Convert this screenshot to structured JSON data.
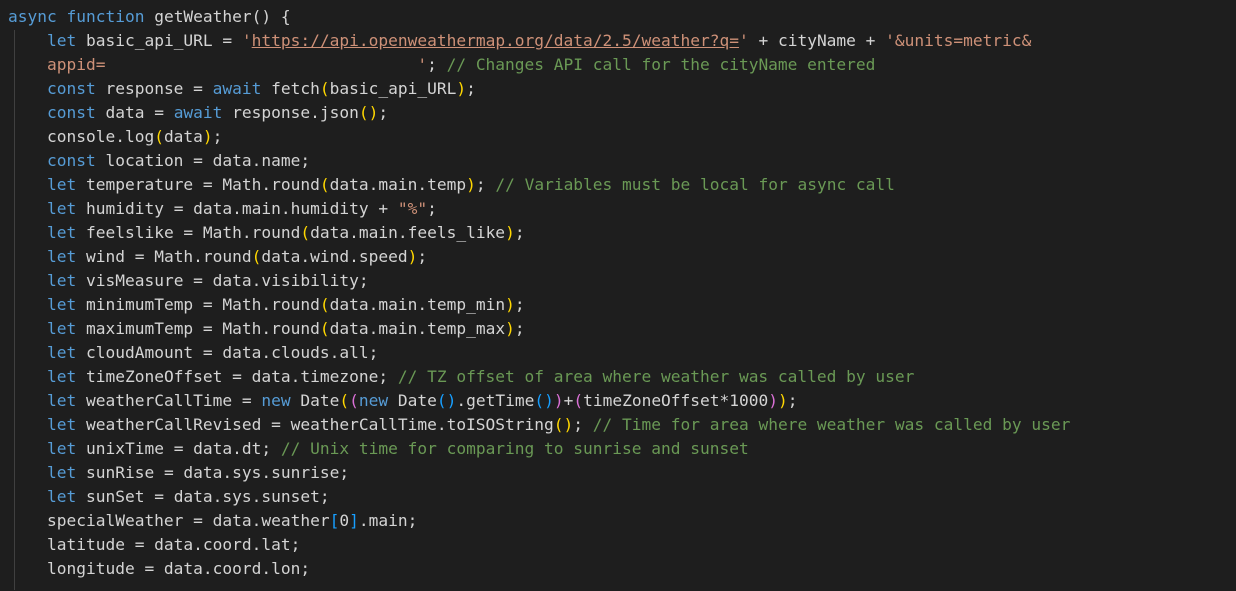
{
  "code_lines": [
    {
      "indent": "",
      "tokens": [
        {
          "t": "async",
          "c": "kw"
        },
        {
          "t": " ",
          "c": "plain"
        },
        {
          "t": "function",
          "c": "kw"
        },
        {
          "t": " getWeather() {",
          "c": "plain"
        }
      ]
    },
    {
      "indent": "    ",
      "tokens": [
        {
          "t": "let",
          "c": "kw"
        },
        {
          "t": " basic_api_URL = ",
          "c": "plain"
        },
        {
          "t": "'",
          "c": "str"
        },
        {
          "t": "https://api.openweathermap.org/data/2.5/weather?q=",
          "c": "link"
        },
        {
          "t": "'",
          "c": "str"
        },
        {
          "t": " + cityName + ",
          "c": "plain"
        },
        {
          "t": "'&units=metric&",
          "c": "str"
        }
      ]
    },
    {
      "indent": "    ",
      "tokens": [
        {
          "t": "appid=                                '",
          "c": "str"
        },
        {
          "t": "; ",
          "c": "plain"
        },
        {
          "t": "// Changes API call for the cityName entered",
          "c": "com"
        }
      ]
    },
    {
      "indent": "    ",
      "tokens": [
        {
          "t": "const",
          "c": "kw"
        },
        {
          "t": " response = ",
          "c": "plain"
        },
        {
          "t": "await",
          "c": "kw"
        },
        {
          "t": " fetch",
          "c": "plain"
        },
        {
          "t": "(",
          "c": "p1"
        },
        {
          "t": "basic_api_URL",
          "c": "plain"
        },
        {
          "t": ")",
          "c": "p1"
        },
        {
          "t": ";",
          "c": "plain"
        }
      ]
    },
    {
      "indent": "    ",
      "tokens": [
        {
          "t": "const",
          "c": "kw"
        },
        {
          "t": " data = ",
          "c": "plain"
        },
        {
          "t": "await",
          "c": "kw"
        },
        {
          "t": " response.json",
          "c": "plain"
        },
        {
          "t": "()",
          "c": "p1"
        },
        {
          "t": ";",
          "c": "plain"
        }
      ]
    },
    {
      "indent": "    ",
      "tokens": [
        {
          "t": "console.log",
          "c": "plain"
        },
        {
          "t": "(",
          "c": "p1"
        },
        {
          "t": "data",
          "c": "plain"
        },
        {
          "t": ")",
          "c": "p1"
        },
        {
          "t": ";",
          "c": "plain"
        }
      ]
    },
    {
      "indent": "    ",
      "tokens": [
        {
          "t": "const",
          "c": "kw"
        },
        {
          "t": " location = data.name;",
          "c": "plain"
        }
      ]
    },
    {
      "indent": "    ",
      "tokens": [
        {
          "t": "let",
          "c": "kw"
        },
        {
          "t": " temperature = Math.round",
          "c": "plain"
        },
        {
          "t": "(",
          "c": "p1"
        },
        {
          "t": "data.main.temp",
          "c": "plain"
        },
        {
          "t": ")",
          "c": "p1"
        },
        {
          "t": "; ",
          "c": "plain"
        },
        {
          "t": "// Variables must be local for async call",
          "c": "com"
        }
      ]
    },
    {
      "indent": "    ",
      "tokens": [
        {
          "t": "let",
          "c": "kw"
        },
        {
          "t": " humidity = data.main.humidity + ",
          "c": "plain"
        },
        {
          "t": "\"%\"",
          "c": "str"
        },
        {
          "t": ";",
          "c": "plain"
        }
      ]
    },
    {
      "indent": "    ",
      "tokens": [
        {
          "t": "let",
          "c": "kw"
        },
        {
          "t": " feelslike = Math.round",
          "c": "plain"
        },
        {
          "t": "(",
          "c": "p1"
        },
        {
          "t": "data.main.feels_like",
          "c": "plain"
        },
        {
          "t": ")",
          "c": "p1"
        },
        {
          "t": ";",
          "c": "plain"
        }
      ]
    },
    {
      "indent": "    ",
      "tokens": [
        {
          "t": "let",
          "c": "kw"
        },
        {
          "t": " wind = Math.round",
          "c": "plain"
        },
        {
          "t": "(",
          "c": "p1"
        },
        {
          "t": "data.wind.speed",
          "c": "plain"
        },
        {
          "t": ")",
          "c": "p1"
        },
        {
          "t": ";",
          "c": "plain"
        }
      ]
    },
    {
      "indent": "    ",
      "tokens": [
        {
          "t": "let",
          "c": "kw"
        },
        {
          "t": " visMeasure = data.visibility;",
          "c": "plain"
        }
      ]
    },
    {
      "indent": "    ",
      "tokens": [
        {
          "t": "let",
          "c": "kw"
        },
        {
          "t": " minimumTemp = Math.round",
          "c": "plain"
        },
        {
          "t": "(",
          "c": "p1"
        },
        {
          "t": "data.main.temp_min",
          "c": "plain"
        },
        {
          "t": ")",
          "c": "p1"
        },
        {
          "t": ";",
          "c": "plain"
        }
      ]
    },
    {
      "indent": "    ",
      "tokens": [
        {
          "t": "let",
          "c": "kw"
        },
        {
          "t": " maximumTemp = Math.round",
          "c": "plain"
        },
        {
          "t": "(",
          "c": "p1"
        },
        {
          "t": "data.main.temp_max",
          "c": "plain"
        },
        {
          "t": ")",
          "c": "p1"
        },
        {
          "t": ";",
          "c": "plain"
        }
      ]
    },
    {
      "indent": "    ",
      "tokens": [
        {
          "t": "let",
          "c": "kw"
        },
        {
          "t": " cloudAmount = data.clouds.all;",
          "c": "plain"
        }
      ]
    },
    {
      "indent": "    ",
      "tokens": [
        {
          "t": "let",
          "c": "kw"
        },
        {
          "t": " timeZoneOffset = data.timezone; ",
          "c": "plain"
        },
        {
          "t": "// TZ offset of area where weather was called by user",
          "c": "com"
        }
      ]
    },
    {
      "indent": "    ",
      "tokens": [
        {
          "t": "let",
          "c": "kw"
        },
        {
          "t": " weatherCallTime = ",
          "c": "plain"
        },
        {
          "t": "new",
          "c": "kw"
        },
        {
          "t": " Date",
          "c": "plain"
        },
        {
          "t": "(",
          "c": "p1"
        },
        {
          "t": "(",
          "c": "p2"
        },
        {
          "t": "new",
          "c": "kw"
        },
        {
          "t": " Date",
          "c": "plain"
        },
        {
          "t": "()",
          "c": "p3"
        },
        {
          "t": ".getTime",
          "c": "plain"
        },
        {
          "t": "()",
          "c": "p3"
        },
        {
          "t": ")",
          "c": "p2"
        },
        {
          "t": "+",
          "c": "plain"
        },
        {
          "t": "(",
          "c": "p2"
        },
        {
          "t": "timeZoneOffset*1000",
          "c": "plain"
        },
        {
          "t": ")",
          "c": "p2"
        },
        {
          "t": ")",
          "c": "p1"
        },
        {
          "t": ";",
          "c": "plain"
        }
      ]
    },
    {
      "indent": "    ",
      "tokens": [
        {
          "t": "let",
          "c": "kw"
        },
        {
          "t": " weatherCallRevised = weatherCallTime.toISOString",
          "c": "plain"
        },
        {
          "t": "()",
          "c": "p1"
        },
        {
          "t": "; ",
          "c": "plain"
        },
        {
          "t": "// Time for area where weather was called by user",
          "c": "com"
        }
      ]
    },
    {
      "indent": "    ",
      "tokens": [
        {
          "t": "let",
          "c": "kw"
        },
        {
          "t": " unixTime = data.dt; ",
          "c": "plain"
        },
        {
          "t": "// Unix time for comparing to sunrise and sunset",
          "c": "com"
        }
      ]
    },
    {
      "indent": "    ",
      "tokens": [
        {
          "t": "let",
          "c": "kw"
        },
        {
          "t": " sunRise = data.sys.sunrise;",
          "c": "plain"
        }
      ]
    },
    {
      "indent": "    ",
      "tokens": [
        {
          "t": "let",
          "c": "kw"
        },
        {
          "t": " sunSet = data.sys.sunset;",
          "c": "plain"
        }
      ]
    },
    {
      "indent": "    ",
      "tokens": [
        {
          "t": "specialWeather = data.weather",
          "c": "plain"
        },
        {
          "t": "[",
          "c": "p3"
        },
        {
          "t": "0",
          "c": "plain"
        },
        {
          "t": "]",
          "c": "p3"
        },
        {
          "t": ".main;",
          "c": "plain"
        }
      ]
    },
    {
      "indent": "    ",
      "tokens": [
        {
          "t": "latitude = data.coord.lat;",
          "c": "plain"
        }
      ]
    },
    {
      "indent": "    ",
      "tokens": [
        {
          "t": "longitude = data.coord.lon;",
          "c": "plain"
        }
      ]
    }
  ],
  "colors": {
    "background": "#1e1e1e",
    "keyword": "#569cd6",
    "string": "#ce9178",
    "comment": "#6a9955",
    "text": "#d4d4d4",
    "bracket_level1": "#ffd700",
    "bracket_level2": "#da70d6",
    "bracket_level3": "#179fff"
  }
}
